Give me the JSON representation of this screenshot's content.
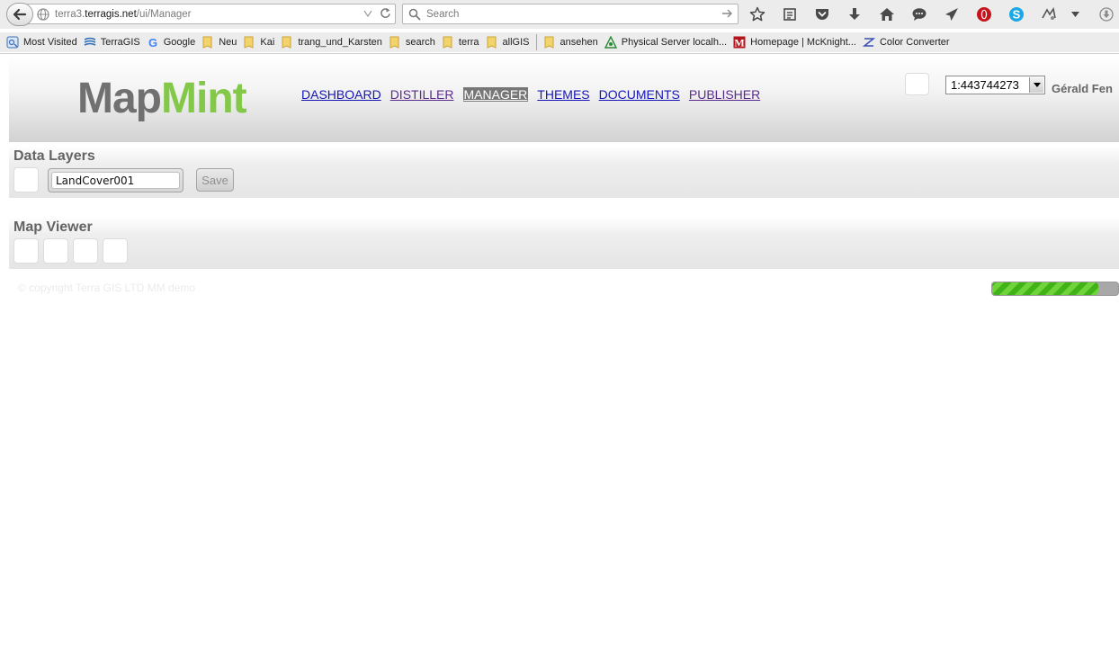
{
  "browser": {
    "url_prefix": "terra3.",
    "url_host": "terragis.net",
    "url_path": "/ui/Manager",
    "search_placeholder": "Search",
    "bookmarks": [
      {
        "label": "Most Visited",
        "icon": "most-visited-icon"
      },
      {
        "label": "TerraGIS",
        "icon": "terragis-icon"
      },
      {
        "label": "Google",
        "icon": "google-icon"
      },
      {
        "label": "Neu",
        "icon": "folder-icon"
      },
      {
        "label": "Kai",
        "icon": "folder-icon"
      },
      {
        "label": "trang_und_Karsten",
        "icon": "folder-icon"
      },
      {
        "label": "search",
        "icon": "folder-icon"
      },
      {
        "label": "terra",
        "icon": "folder-icon"
      },
      {
        "label": "allGIS",
        "icon": "folder-icon"
      },
      {
        "label": "ansehen",
        "icon": "folder-icon"
      },
      {
        "label": "Physical Server localh...",
        "icon": "server-icon"
      },
      {
        "label": "Homepage | McKnight...",
        "icon": "mcknight-icon"
      },
      {
        "label": "Color Converter",
        "icon": "color-converter-icon"
      }
    ]
  },
  "app": {
    "logo_part1": "Map",
    "logo_part2": "Mint",
    "nav": [
      {
        "label": "DASHBOARD",
        "state": "normal"
      },
      {
        "label": "DISTILLER",
        "state": "visited"
      },
      {
        "label": "MANAGER",
        "state": "active"
      },
      {
        "label": "THEMES",
        "state": "normal"
      },
      {
        "label": "DOCUMENTS",
        "state": "normal"
      },
      {
        "label": "PUBLISHER",
        "state": "visited"
      }
    ],
    "scale": "1:443744273",
    "user": "Gérald Fen"
  },
  "data_layers": {
    "title": "Data Layers",
    "layer_name": "LandCover001",
    "save_label": "Save"
  },
  "map_viewer": {
    "title": "Map Viewer"
  },
  "footer": {
    "copyright": "© copyright Terra GIS LTD MM demo",
    "progress": 0.84
  },
  "colors": {
    "logo_gray": "#707070",
    "logo_green": "#83c849",
    "nav_link": "#1515b7",
    "nav_active_bg": "#777777",
    "progress_green": "#4fc122"
  }
}
